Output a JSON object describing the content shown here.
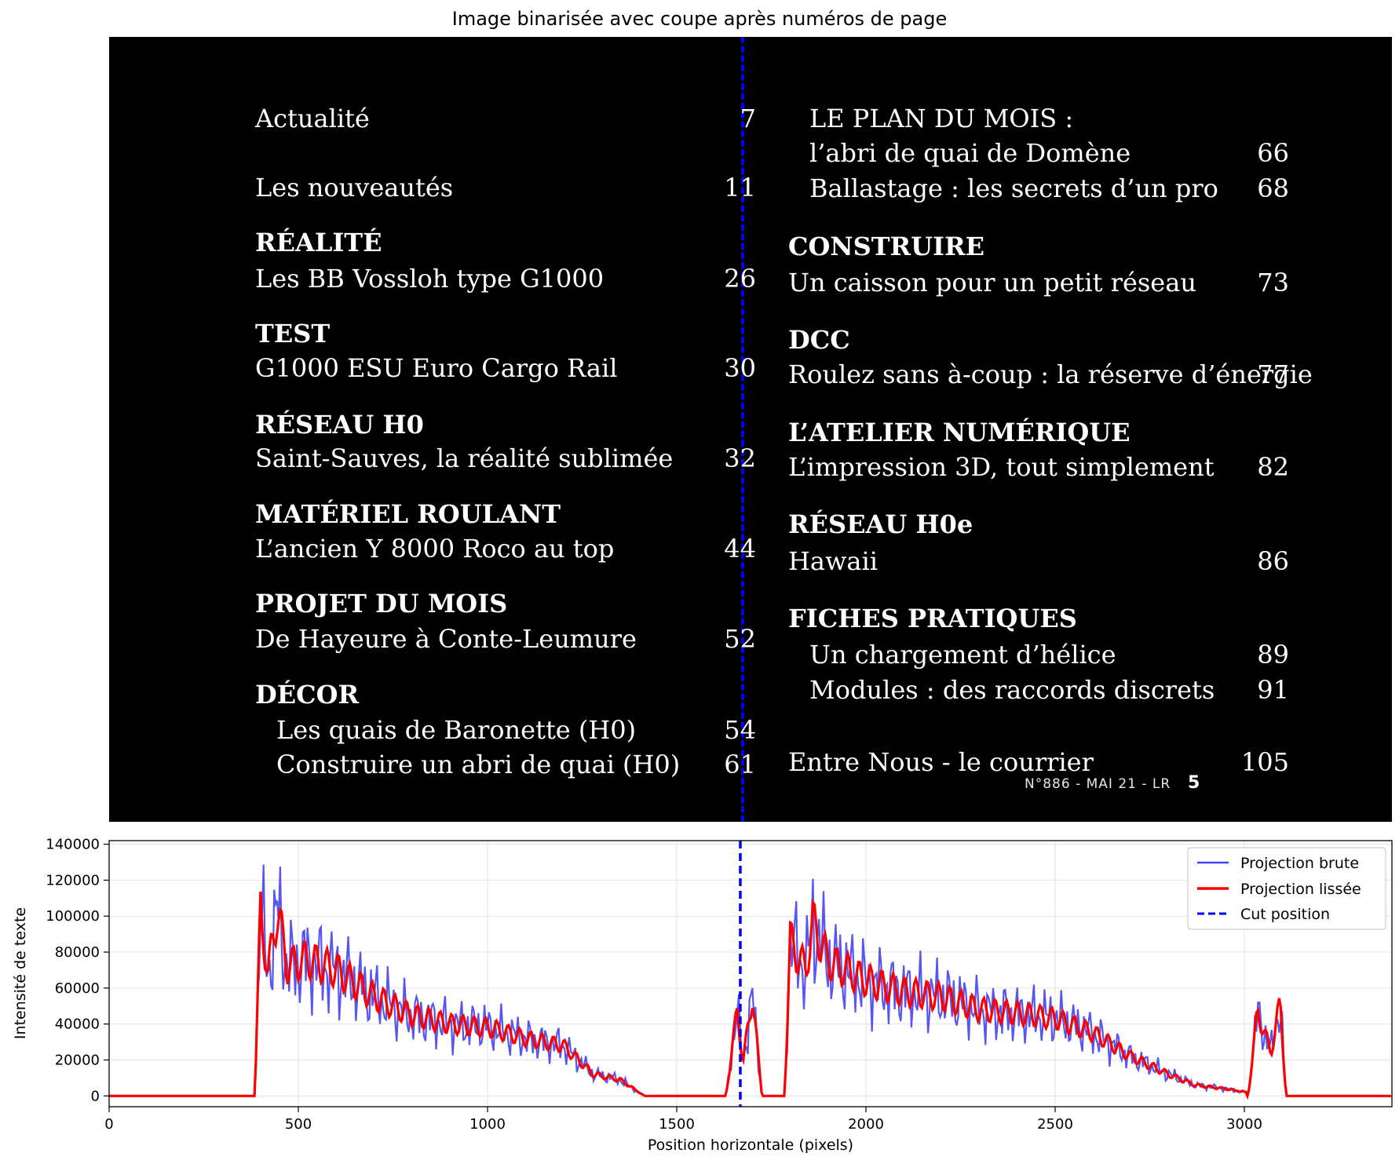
{
  "title": "Image binarisée avec coupe après numéros de page",
  "toc": {
    "left": [
      {
        "text": "Actualité",
        "page": "7",
        "kind": "entry"
      },
      {
        "text": "Les nouveautés",
        "page": "11",
        "kind": "entry"
      },
      {
        "text": "RÉALITÉ",
        "page": "",
        "kind": "section"
      },
      {
        "text": "Les BB Vossloh type G1000",
        "page": "26",
        "kind": "entry"
      },
      {
        "text": "TEST",
        "page": "",
        "kind": "section"
      },
      {
        "text": "G1000 ESU Euro Cargo Rail",
        "page": "30",
        "kind": "entry"
      },
      {
        "text": "RÉSEAU H0",
        "page": "",
        "kind": "section"
      },
      {
        "text": "Saint-Sauves, la réalité sublimée",
        "page": "32",
        "kind": "entry"
      },
      {
        "text": "MATÉRIEL ROULANT",
        "page": "",
        "kind": "section"
      },
      {
        "text": "L’ancien Y 8000 Roco au top",
        "page": "44",
        "kind": "entry"
      },
      {
        "text": "PROJET DU MOIS",
        "page": "",
        "kind": "section"
      },
      {
        "text": "De Hayeure à Conte-Leumure",
        "page": "52",
        "kind": "entry"
      },
      {
        "text": "DÉCOR",
        "page": "",
        "kind": "section"
      },
      {
        "text": "Les quais de Baronette (H0)",
        "page": "54",
        "kind": "subentry"
      },
      {
        "text": "Construire un abri de quai (H0)",
        "page": "61",
        "kind": "subentry"
      }
    ],
    "right": [
      {
        "text": "LE PLAN DU MOIS :",
        "page": "",
        "kind": "subentry"
      },
      {
        "text": "l’abri de quai de Domène",
        "page": "66",
        "kind": "subentry"
      },
      {
        "text": "Ballastage : les secrets d’un pro",
        "page": "68",
        "kind": "subentry"
      },
      {
        "text": "CONSTRUIRE",
        "page": "",
        "kind": "section"
      },
      {
        "text": "Un caisson pour un petit réseau",
        "page": "73",
        "kind": "entry"
      },
      {
        "text": "DCC",
        "page": "",
        "kind": "section"
      },
      {
        "text": "Roulez sans à-coup : la réserve d’énergie",
        "page": "77",
        "kind": "entry"
      },
      {
        "text": "L’ATELIER NUMÉRIQUE",
        "page": "",
        "kind": "section"
      },
      {
        "text": "L’impression 3D, tout simplement",
        "page": "82",
        "kind": "entry"
      },
      {
        "text": "RÉSEAU H0e",
        "page": "",
        "kind": "section"
      },
      {
        "text": "Hawaii",
        "page": "86",
        "kind": "entry"
      },
      {
        "text": "FICHES PRATIQUES",
        "page": "",
        "kind": "section"
      },
      {
        "text": "Un chargement d’hélice",
        "page": "89",
        "kind": "subentry"
      },
      {
        "text": "Modules : des raccords discrets",
        "page": "91",
        "kind": "subentry"
      },
      {
        "text": "Entre Nous - le courrier",
        "page": "105",
        "kind": "entry"
      }
    ],
    "footer": "N°886 - MAI 21 - LR",
    "footer_page": "5"
  },
  "chart_data": {
    "type": "line",
    "xlabel": "Position horizontale (pixels)",
    "ylabel": "Intensité de texte",
    "xlim": [
      0,
      3390
    ],
    "ylim": [
      -6000,
      142000
    ],
    "xticks": [
      0,
      500,
      1000,
      1500,
      2000,
      2500,
      3000
    ],
    "yticks": [
      0,
      20000,
      40000,
      60000,
      80000,
      100000,
      120000,
      140000
    ],
    "grid": true,
    "legend_position": "top-right",
    "cut_position": 1668,
    "colors": {
      "raw": "#4444ee",
      "smooth": "#ff0000",
      "cut": "#0000ff"
    },
    "legend": [
      "Projection brute",
      "Projection lissée",
      "Cut position"
    ],
    "segments": [
      {
        "x0": 385,
        "x1": 1415,
        "peaks": [
          [
            385,
            0
          ],
          [
            400,
            103000
          ],
          [
            420,
            68000
          ],
          [
            445,
            104000
          ],
          [
            470,
            72000
          ],
          [
            520,
            76000
          ],
          [
            600,
            70000
          ],
          [
            700,
            55000
          ],
          [
            800,
            45000
          ],
          [
            900,
            40000
          ],
          [
            1000,
            38000
          ],
          [
            1100,
            32000
          ],
          [
            1200,
            28000
          ],
          [
            1280,
            12000
          ],
          [
            1350,
            9000
          ],
          [
            1415,
            0
          ]
        ]
      },
      {
        "x0": 1630,
        "x1": 1725,
        "peaks": [
          [
            1630,
            0
          ],
          [
            1660,
            48000
          ],
          [
            1675,
            18000
          ],
          [
            1700,
            56000
          ],
          [
            1725,
            0
          ]
        ]
      },
      {
        "x0": 1785,
        "x1": 2870,
        "peaks": [
          [
            1785,
            0
          ],
          [
            1800,
            86000
          ],
          [
            1840,
            70000
          ],
          [
            1860,
            96000
          ],
          [
            1900,
            75000
          ],
          [
            2000,
            64000
          ],
          [
            2100,
            58000
          ],
          [
            2200,
            55000
          ],
          [
            2300,
            48000
          ],
          [
            2400,
            46000
          ],
          [
            2500,
            43000
          ],
          [
            2600,
            35000
          ],
          [
            2700,
            22000
          ],
          [
            2800,
            12000
          ],
          [
            2870,
            6000
          ]
        ]
      },
      {
        "x0": 2870,
        "x1": 3005,
        "peaks": [
          [
            2870,
            6000
          ],
          [
            2950,
            4000
          ],
          [
            3005,
            2000
          ]
        ]
      },
      {
        "x0": 3010,
        "x1": 3110,
        "peaks": [
          [
            3010,
            0
          ],
          [
            3035,
            47000
          ],
          [
            3070,
            24000
          ],
          [
            3095,
            52000
          ],
          [
            3110,
            0
          ]
        ]
      }
    ]
  }
}
